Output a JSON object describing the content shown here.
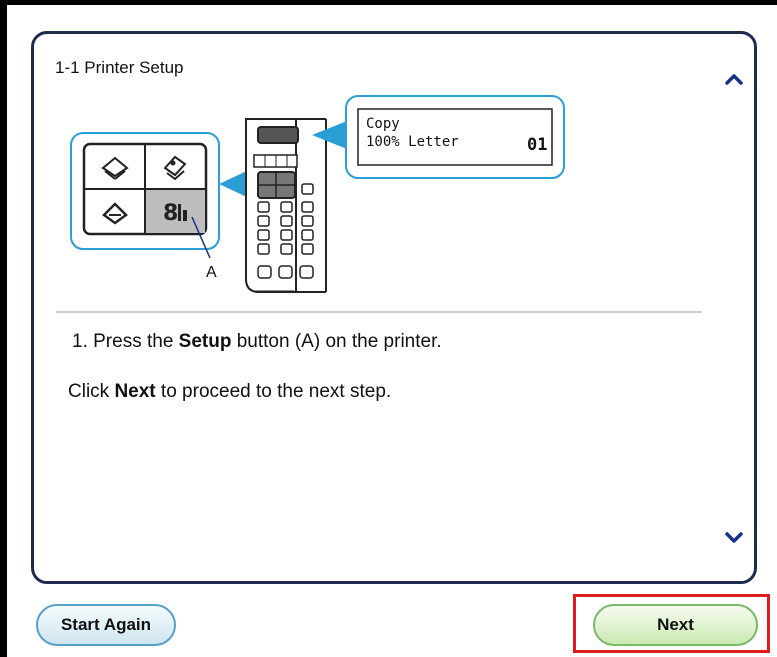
{
  "panel": {
    "title": "1-1 Printer Setup"
  },
  "illustration": {
    "lcd_line1": "Copy",
    "lcd_line2": "100% Letter",
    "lcd_count": "01",
    "callout_label": "A"
  },
  "instructions": {
    "step_prefix": "1. Press the ",
    "step_bold": "Setup",
    "step_suffix": " button (A) on the printer.",
    "hint_prefix": "Click ",
    "hint_bold": "Next",
    "hint_suffix": " to proceed to the next step."
  },
  "buttons": {
    "start_again": "Start Again",
    "next": "Next"
  },
  "colors": {
    "panel_border": "#1f2b4d",
    "callout_blue": "#2a9fd6",
    "highlight_red": "#e01b1b",
    "next_green": "#cbe9b3",
    "start_blue": "#cfe6ef"
  }
}
